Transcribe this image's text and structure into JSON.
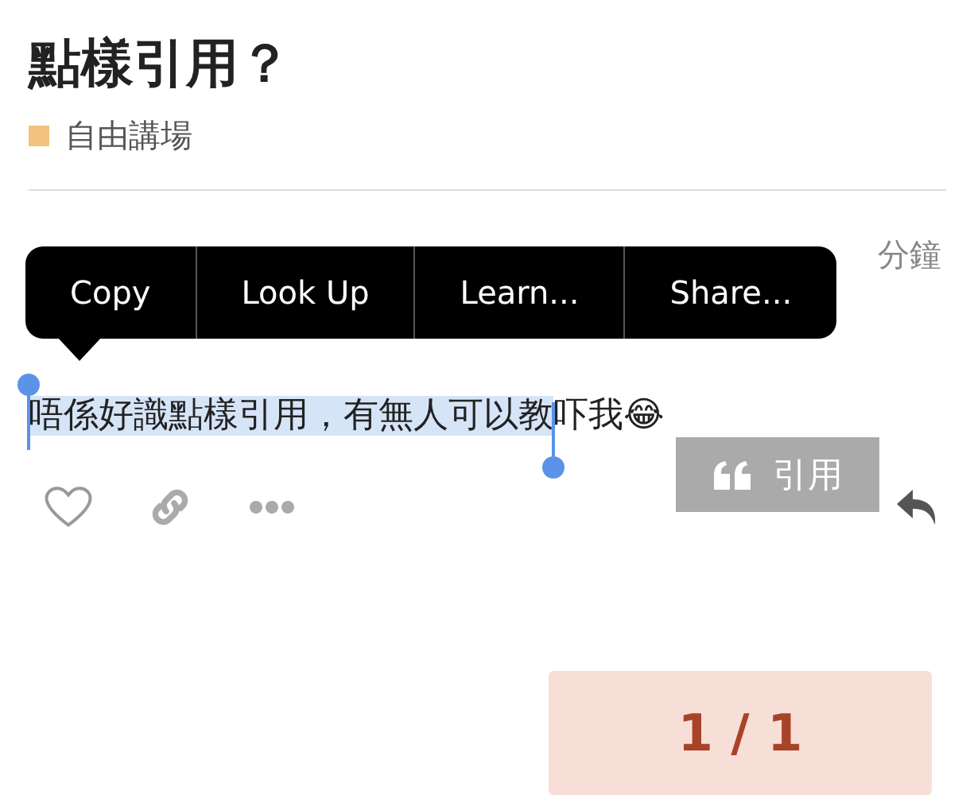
{
  "topic": {
    "title": "點樣引用？",
    "category": {
      "name": "自由講場",
      "color": "#f2c27e"
    }
  },
  "post": {
    "time": "分鐘",
    "segments": [
      {
        "text": "唔係好識點樣引用，有無人可以教",
        "selected": true
      },
      {
        "text": "吓我😂",
        "selected": false
      }
    ]
  },
  "context_menu": {
    "items": [
      "Copy",
      "Look Up",
      "Learn...",
      "Share..."
    ]
  },
  "quote_button": {
    "label": "引用"
  },
  "progress": {
    "current": "1",
    "separator": "/",
    "total": "1"
  }
}
